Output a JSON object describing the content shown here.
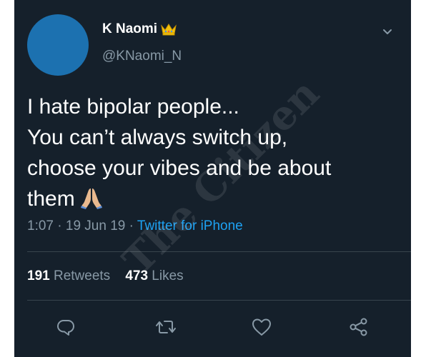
{
  "tweet": {
    "author": {
      "display_name": "K Naomi",
      "handle": "@KNaomi_N",
      "avatar_color": "#1c71b0"
    },
    "text_lines": [
      "I hate bipolar people...",
      "You can’t always switch up,",
      "choose your vibes and be about",
      "them"
    ],
    "emoji": "folded-hands-emoji",
    "time": "1:07",
    "separator": "·",
    "date": "19 Jun 19",
    "source": "Twitter for iPhone",
    "stats": {
      "retweets_count": "191",
      "retweets_label": "Retweets",
      "likes_count": "473",
      "likes_label": "Likes"
    },
    "actions": [
      "reply-icon",
      "retweet-icon",
      "like-icon",
      "share-icon"
    ]
  },
  "watermark": {
    "text": "The Citizen"
  },
  "colors": {
    "background": "#15202b",
    "text": "#ffffff",
    "secondary_text": "#8899a6",
    "link": "#1da1f2",
    "divider": "#38444d"
  }
}
